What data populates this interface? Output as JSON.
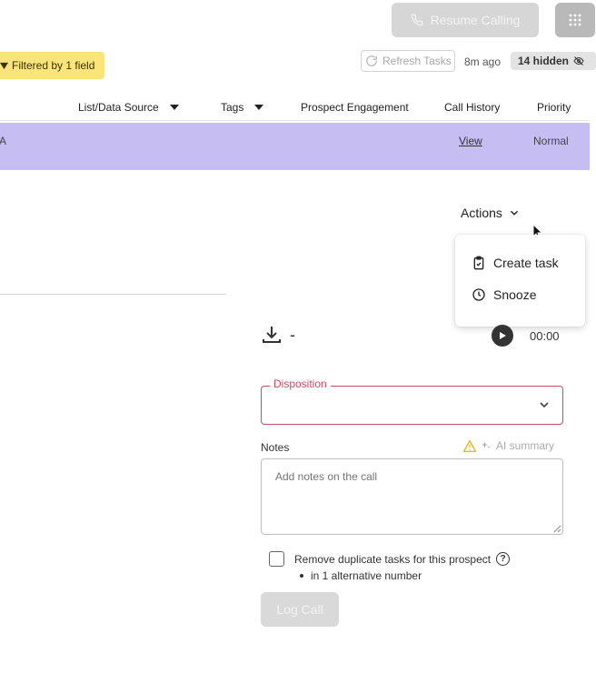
{
  "toolbar": {
    "resume_label": "Resume Calling",
    "refresh_label": "Refresh Tasks",
    "refresh_ago": "8m ago",
    "hidden_count": "14 hidden"
  },
  "filter": {
    "label": "Filtered by 1 field"
  },
  "table": {
    "columns": [
      "List/Data Source",
      "Tags",
      "Prospect Engagement",
      "Call History",
      "Priority"
    ],
    "row": {
      "partial_first": "A",
      "call_history": "View",
      "priority": "Normal"
    }
  },
  "actions": {
    "label": "Actions",
    "menu": [
      {
        "label": "Create task",
        "icon": "clipboard-check-icon"
      },
      {
        "label": "Snooze",
        "icon": "clock-icon"
      }
    ]
  },
  "recording": {
    "dash": "-",
    "time": "00:00"
  },
  "form": {
    "disposition_label": "Disposition",
    "notes_label": "Notes",
    "ai_summary_label": "AI summary",
    "notes_placeholder": "Add notes on the call",
    "remove_dup_label": "Remove duplicate tasks for this prospect",
    "alt_number_note": "in 1 alternative number",
    "log_call_label": "Log Call"
  },
  "colors": {
    "row_highlight": "#c6bdf3",
    "filter_badge": "#fbe57a",
    "disposition_border": "#c94b62",
    "warning": "#e0b000"
  }
}
